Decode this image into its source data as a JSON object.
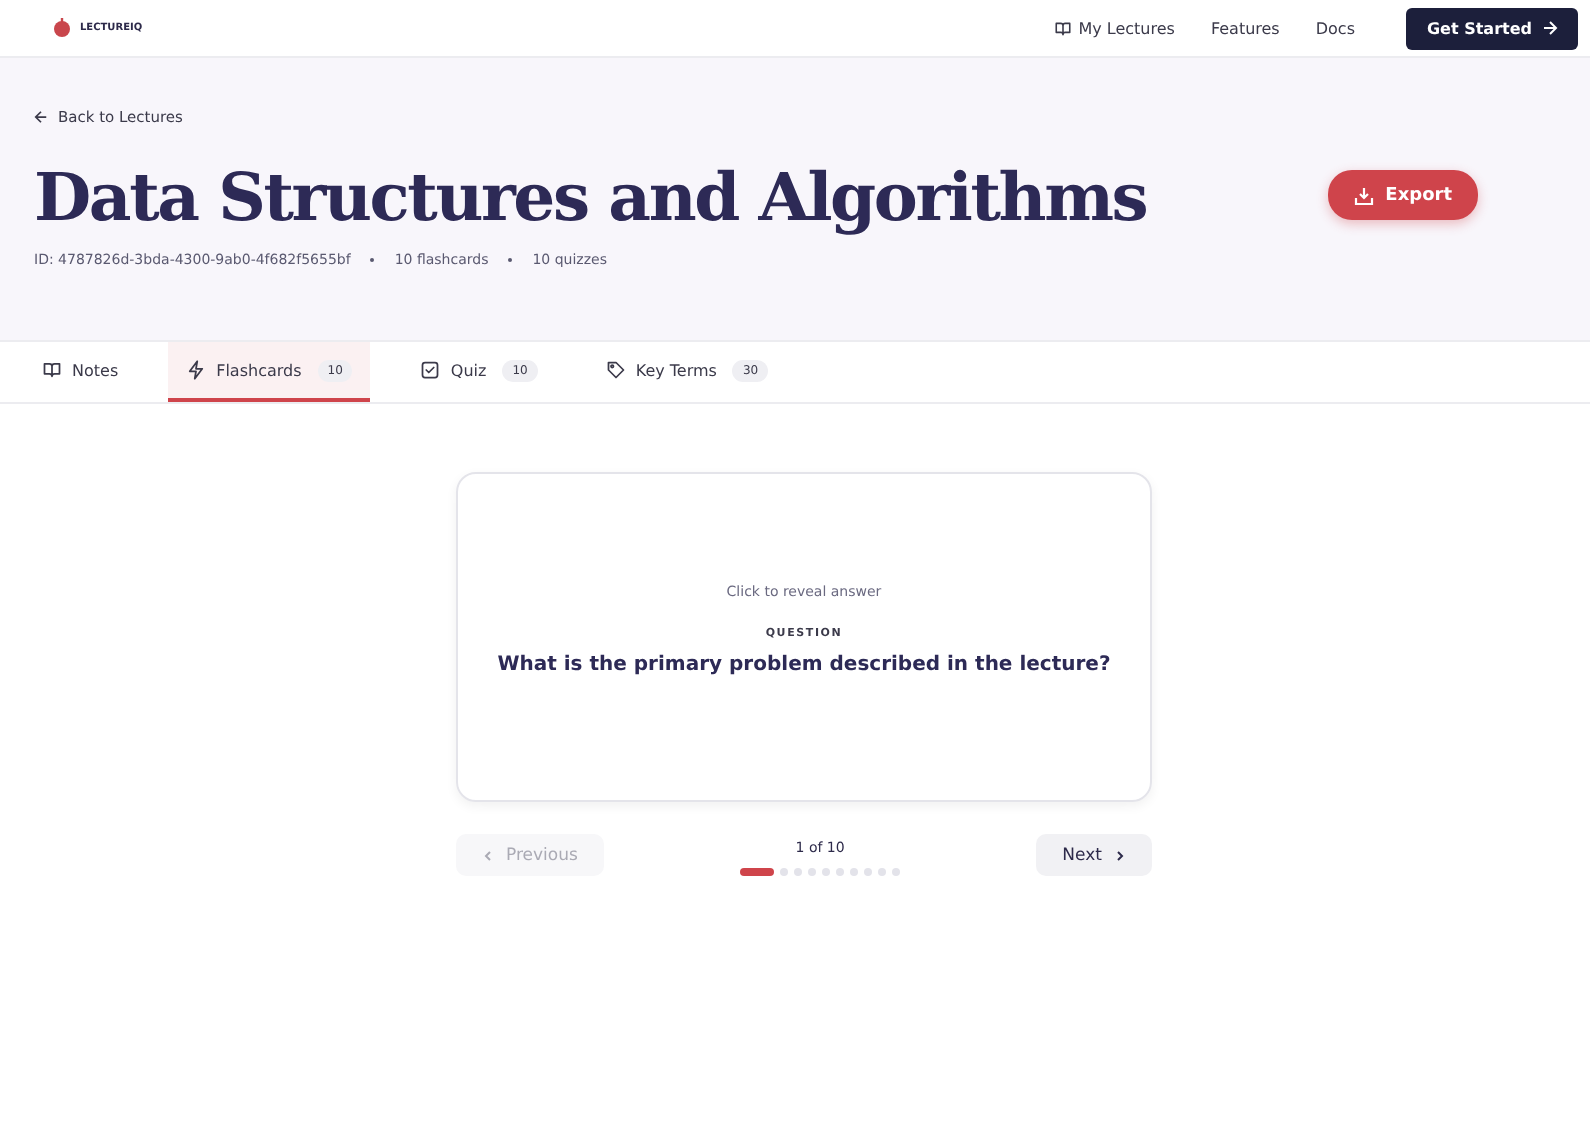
{
  "header": {
    "logo": "LECTUREIQ",
    "nav": [
      {
        "label": "My Lectures",
        "kind": "book"
      },
      {
        "label": "Features",
        "kind": "plain"
      },
      {
        "label": "Docs",
        "kind": "plain"
      }
    ],
    "cta": "Get Started"
  },
  "hero": {
    "back": "Back to Lectures",
    "title": "Data Structures and Algorithms",
    "meta": [
      "ID: 4787826d-3bda-4300-9ab0-4f682f5655bf",
      "10 flashcards",
      "10 quizzes"
    ],
    "export": "Export"
  },
  "tabs": [
    {
      "label": "Notes",
      "kind": "book",
      "selected": false
    },
    {
      "label": "Flashcards",
      "kind": "bolt",
      "count": "10",
      "selected": true
    },
    {
      "label": "Quiz",
      "kind": "check",
      "count": "10",
      "selected": false
    },
    {
      "label": "Key Terms",
      "kind": "tag",
      "count": "30",
      "selected": false
    }
  ],
  "card": {
    "hint": "Click to reveal answer",
    "label": "QUESTION",
    "question": "What is the primary problem described in the lecture?"
  },
  "pager": {
    "previous": {
      "label": "Previous",
      "disabled": true
    },
    "position": "1 of 10",
    "next": {
      "label": "Next",
      "disabled": false
    },
    "dots": [
      {
        "selected": true
      },
      {
        "selected": false
      },
      {
        "selected": false
      },
      {
        "selected": false
      },
      {
        "selected": false
      },
      {
        "selected": false
      },
      {
        "selected": false
      },
      {
        "selected": false
      },
      {
        "selected": false
      },
      {
        "selected": false
      }
    ]
  }
}
